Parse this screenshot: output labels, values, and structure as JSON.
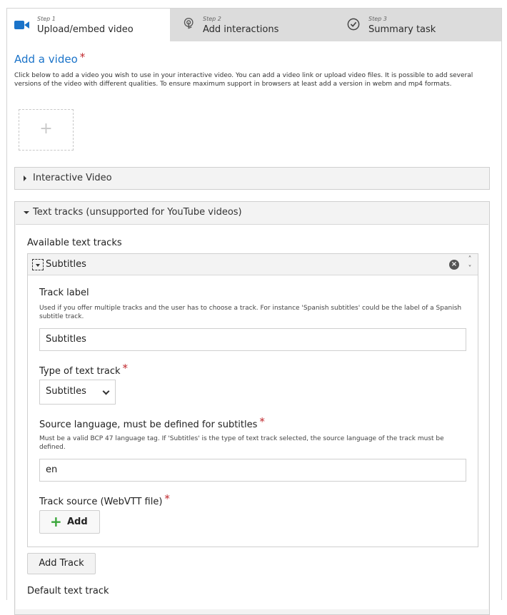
{
  "tabs": [
    {
      "step": "Step 1",
      "name": "Upload/embed video",
      "icon": "video-camera-icon"
    },
    {
      "step": "Step 2",
      "name": "Add interactions",
      "icon": "touch-icon"
    },
    {
      "step": "Step 3",
      "name": "Summary task",
      "icon": "check-circle-icon"
    }
  ],
  "add_video": {
    "title": "Add a video",
    "required_mark": "*",
    "description": "Click below to add a video you wish to use in your interactive video. You can add a video link or upload video files. It is possible to add several versions of the video with different qualities. To ensure maximum support in browsers at least add a version in webm and mp4 formats.",
    "add_symbol": "+"
  },
  "groups": {
    "interactive_video": "Interactive Video",
    "text_tracks": "Text tracks (unsupported for YouTube videos)"
  },
  "text_tracks": {
    "available_label": "Available text tracks",
    "track_title": "Subtitles",
    "remove_symbol": "×",
    "up_symbol": "˄",
    "down_symbol": "˅",
    "track_label": {
      "label": "Track label",
      "description": "Used if you offer multiple tracks and the user has to choose a track. For instance 'Spanish subtitles' could be the label of a Spanish subtitle track.",
      "value": "Subtitles"
    },
    "track_type": {
      "label": "Type of text track",
      "required_mark": "*",
      "value": "Subtitles"
    },
    "source_language": {
      "label": "Source language, must be defined for subtitles",
      "required_mark": "*",
      "description": "Must be a valid BCP 47 language tag. If 'Subtitles' is the type of text track selected, the source language of the track must be defined.",
      "value": "en"
    },
    "track_source": {
      "label": "Track source (WebVTT file)",
      "required_mark": "*",
      "add_symbol": "+",
      "add_label": "Add"
    },
    "add_track_label": "Add Track",
    "default_track_label": "Default text track"
  },
  "colors": {
    "accent": "#1a73c9",
    "required": "#c0272d",
    "add_green": "#3aa63a"
  }
}
